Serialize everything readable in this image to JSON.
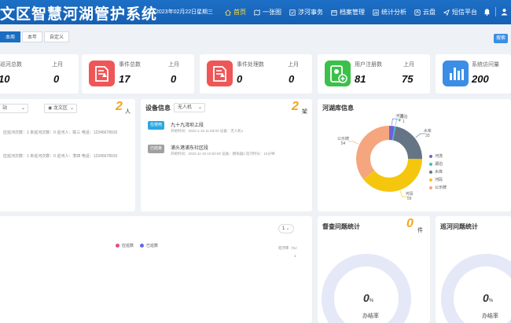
{
  "header": {
    "title": "文区智慧河湖管护系统",
    "date": "2023年02月22日",
    "weekday": "星期三",
    "nav": [
      {
        "label": "首页",
        "icon": "home-icon",
        "active": true
      },
      {
        "label": "一张图",
        "icon": "map-icon",
        "active": false
      },
      {
        "label": "涉河事务",
        "icon": "task-icon",
        "active": false
      },
      {
        "label": "档案管理",
        "icon": "archive-icon",
        "active": false
      },
      {
        "label": "统计分析",
        "icon": "analytics-icon",
        "active": false
      },
      {
        "label": "云盘",
        "icon": "cloud-icon",
        "active": false
      },
      {
        "label": "短信平台",
        "icon": "send-icon",
        "active": false
      }
    ]
  },
  "tabs": [
    {
      "label": "本周",
      "active": true
    },
    {
      "label": "本年",
      "active": false
    },
    {
      "label": "自定义",
      "active": false
    }
  ],
  "search_label": "搜索",
  "stats": [
    {
      "label": "巡河总数",
      "last_label": "上月",
      "value": "10",
      "last": "0"
    },
    {
      "label": "事件总数",
      "last_label": "上月",
      "value": "17",
      "last": "0"
    },
    {
      "label": "事件处理数",
      "last_label": "上月",
      "value": "0",
      "last": "0"
    },
    {
      "label": "用户注册数",
      "last_label": "上月",
      "value": "81",
      "last": "75"
    },
    {
      "label": "系统访问量",
      "value": "200"
    }
  ],
  "inspector_panel": {
    "select1": "站",
    "select2": "龙文区",
    "count": "2",
    "unit": "人",
    "rows": [
      {
        "text": "应巡河次数：1   未巡河次数：0   巡河人：陈三   电话：12345678910"
      },
      {
        "text": "应巡河次数：1   未巡河次数：0   巡河人：李四   电话：12345678910"
      }
    ]
  },
  "device_panel": {
    "title": "设备信息",
    "select": "无人机",
    "count": "2",
    "unit": "架",
    "devices": [
      {
        "status": "在使用",
        "color": "#2aa8e0",
        "name": "九十九湾坝上段",
        "meta": "开始时间：2022-1-15 11:58:00   设备：无人机1"
      },
      {
        "status": "已结束",
        "color": "#a0a0a0",
        "name": "浦头港浦东社区段",
        "meta": "开始时间：2022-11-15 10:50:00   设备：模拟器2   巡河时长：15分钟"
      }
    ]
  },
  "lake_panel": {
    "title": "河湖库信息",
    "legend": [
      {
        "name": "河流",
        "color": "#6f61d6"
      },
      {
        "name": "湖泊",
        "color": "#36c1c7"
      },
      {
        "name": "水库",
        "color": "#667585"
      },
      {
        "name": "河段",
        "color": "#f4c70e"
      },
      {
        "name": "公示牌",
        "color": "#f5a67e"
      }
    ]
  },
  "chart_data": {
    "type": "pie",
    "categories": [
      "河流",
      "湖泊",
      "水库",
      "河段",
      "公示牌"
    ],
    "values": [
      4,
      1,
      33,
      59,
      54
    ],
    "colors": [
      "#6f61d6",
      "#36c1c7",
      "#667585",
      "#f4c70e",
      "#f5a67e"
    ]
  },
  "bottom_left": {
    "legend": [
      {
        "name": "应巡数",
        "color": "#e84a8a"
      },
      {
        "name": "已巡数",
        "color": "#5b6de8"
      }
    ],
    "select": "1",
    "rate_label": "巡河率（%）",
    "rate_value": "1"
  },
  "supervise": {
    "title": "督查问题统计",
    "count": "0",
    "unit": "件",
    "rate": "0",
    "rate_unit": "%",
    "rate_label": "办结率"
  },
  "patrol_issue": {
    "title": "巡河问题统计",
    "rate": "0",
    "rate_unit": "%",
    "rate_label": "办结率"
  }
}
